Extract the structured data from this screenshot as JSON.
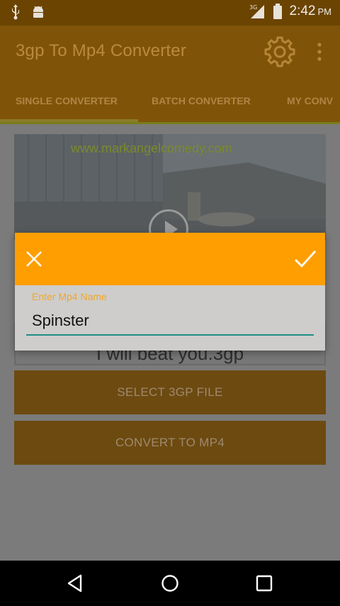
{
  "status_bar": {
    "time": "2:42",
    "ampm": "PM",
    "network": "3G",
    "icons": [
      "usb-icon",
      "android-icon",
      "signal-icon",
      "battery-icon"
    ]
  },
  "app_bar": {
    "title": "3gp To Mp4 Converter",
    "icons": [
      "gear-icon",
      "overflow-menu-icon"
    ]
  },
  "tabs": [
    {
      "label": "SINGLE CONVERTER",
      "selected": true
    },
    {
      "label": "BATCH CONVERTER",
      "selected": false
    },
    {
      "label": "MY CONV",
      "selected": false
    }
  ],
  "video": {
    "watermark": "www.markangelcomedy.com"
  },
  "file": {
    "name": "I will beat you.3gp"
  },
  "buttons": {
    "select": "SELECT 3GP FILE",
    "convert": "CONVERT TO MP4"
  },
  "dialog": {
    "field_label": "Enter Mp4 Name",
    "field_value": "Spinster",
    "icons": [
      "close-icon",
      "check-icon"
    ]
  },
  "nav_bar": {
    "icons": [
      "back-icon",
      "home-icon",
      "recent-apps-icon"
    ]
  },
  "colors": {
    "app_bar": "#805408",
    "dialog_header": "#ff9e01",
    "field_label": "#f3a628",
    "field_underline": "#1f8d85"
  }
}
